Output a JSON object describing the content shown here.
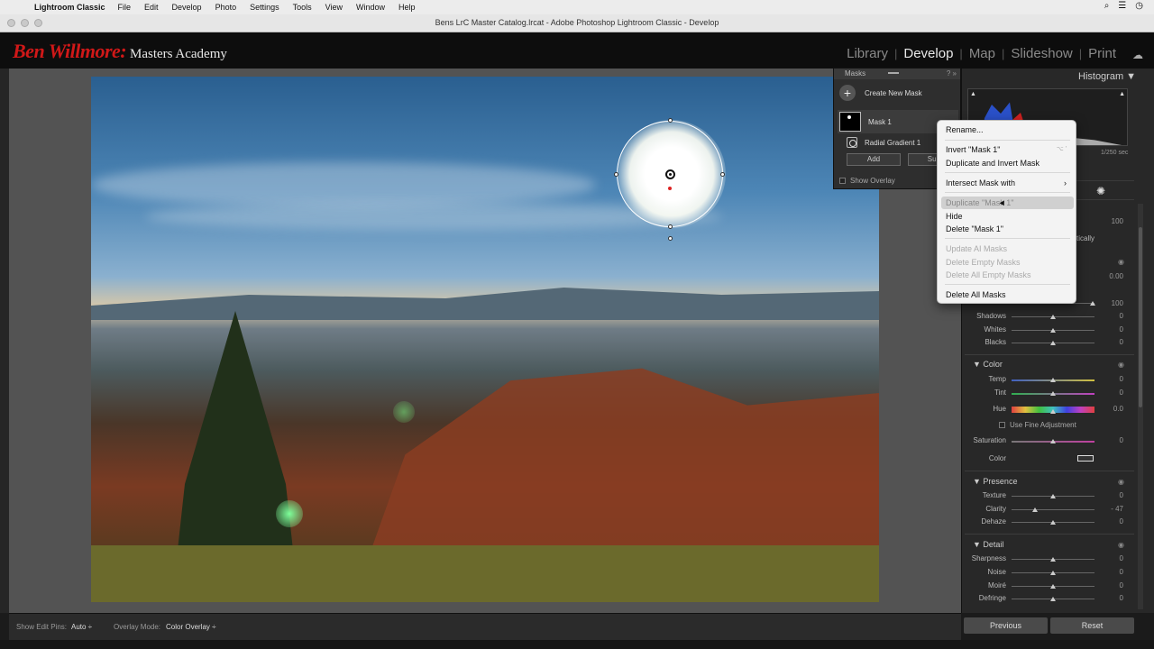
{
  "menubar": {
    "app": "Lightroom Classic",
    "items": [
      "File",
      "Edit",
      "Develop",
      "Photo",
      "Settings",
      "Tools",
      "View",
      "Window",
      "Help"
    ]
  },
  "window": {
    "title": "Bens LrC Master Catalog.lrcat - Adobe Photoshop Lightroom Classic - Develop"
  },
  "identity": {
    "logo_script": "Ben Willmore:",
    "logo_text": "Masters Academy"
  },
  "modules": {
    "items": [
      "Library",
      "Develop",
      "Map",
      "Slideshow",
      "Print"
    ],
    "active": "Develop"
  },
  "masks_panel": {
    "title": "Masks",
    "create_label": "Create New Mask",
    "mask_name": "Mask 1",
    "component_name": "Radial Gradient 1",
    "add_label": "Add",
    "subtract_label": "Subt",
    "show_overlay_label": "Show Overlay"
  },
  "histogram": {
    "title": "Histogram",
    "shutter": "1/250 sec"
  },
  "context_menu": {
    "items": [
      {
        "label": "Rename...",
        "enabled": true
      },
      {
        "label": "Invert \"Mask 1\"",
        "enabled": true,
        "shortcut": "⌥ '"
      },
      {
        "label": "Duplicate and Invert Mask",
        "enabled": true
      },
      {
        "label": "Intersect Mask with",
        "enabled": true,
        "submenu": "›"
      },
      {
        "label": "Duplicate \"Mask 1\"",
        "enabled": true,
        "highlighted": true
      },
      {
        "label": "Hide",
        "enabled": true
      },
      {
        "label": "Delete \"Mask 1\"",
        "enabled": true
      },
      {
        "label": "Update AI Masks",
        "enabled": false
      },
      {
        "label": "Delete Empty Masks",
        "enabled": false
      },
      {
        "label": "Delete All Empty Masks",
        "enabled": false
      },
      {
        "label": "Delete All Masks",
        "enabled": true
      }
    ]
  },
  "partial_labels": {
    "amount_val": "100",
    "vertically": "tically",
    "exposure_val": "0.00",
    "highlights_val": "100"
  },
  "light_rows": [
    {
      "label": "Shadows",
      "value": "0"
    },
    {
      "label": "Whites",
      "value": "0"
    },
    {
      "label": "Blacks",
      "value": "0"
    }
  ],
  "color_section": {
    "title": "Color",
    "rows": [
      {
        "label": "Temp",
        "value": "0"
      },
      {
        "label": "Tint",
        "value": "0"
      },
      {
        "label": "Hue",
        "value": "0.0"
      }
    ],
    "fine_adjust": "Use Fine Adjustment",
    "saturation": {
      "label": "Saturation",
      "value": "0"
    },
    "color_label": "Color"
  },
  "presence_section": {
    "title": "Presence",
    "rows": [
      {
        "label": "Texture",
        "value": "0"
      },
      {
        "label": "Clarity",
        "value": "- 47"
      },
      {
        "label": "Dehaze",
        "value": "0"
      }
    ]
  },
  "detail_section": {
    "title": "Detail",
    "rows": [
      {
        "label": "Sharpness",
        "value": "0"
      },
      {
        "label": "Noise",
        "value": "0"
      },
      {
        "label": "Moiré",
        "value": "0"
      },
      {
        "label": "Defringe",
        "value": "0"
      }
    ]
  },
  "buttons": {
    "previous": "Previous",
    "reset": "Reset"
  },
  "toolbar": {
    "edit_pins_label": "Show Edit Pins:",
    "edit_pins_value": "Auto ÷",
    "overlay_mode_label": "Overlay Mode:",
    "overlay_mode_value": "Color Overlay ÷"
  },
  "colors": {
    "logo_red": "#d01818",
    "panel_bg": "#282828",
    "menu_bg": "#f3f3f3"
  }
}
